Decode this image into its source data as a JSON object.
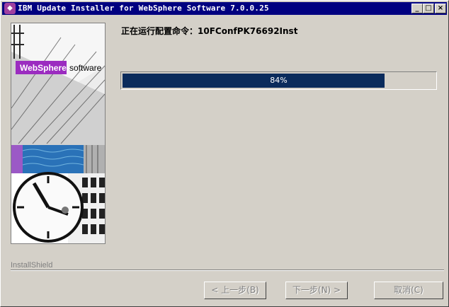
{
  "window": {
    "title": "IBM Update Installer for WebSphere Software 7.0.0.25",
    "controls": {
      "minimize": "_",
      "maximize": "□",
      "close": "×"
    }
  },
  "branding": {
    "product": "WebSphere",
    "suffix": "software",
    "installer": "InstallShield"
  },
  "status": {
    "text": "正在运行配置命令：10FConfPK76692Inst"
  },
  "progress": {
    "value": 84,
    "label": "84%"
  },
  "buttons": {
    "back": "< 上一步(B)",
    "next": "下一步(N) >",
    "cancel": "取消(C)"
  },
  "colors": {
    "titlebar": "#000080",
    "progress": "#0a2b5c",
    "brand": "#9b2cc0"
  }
}
